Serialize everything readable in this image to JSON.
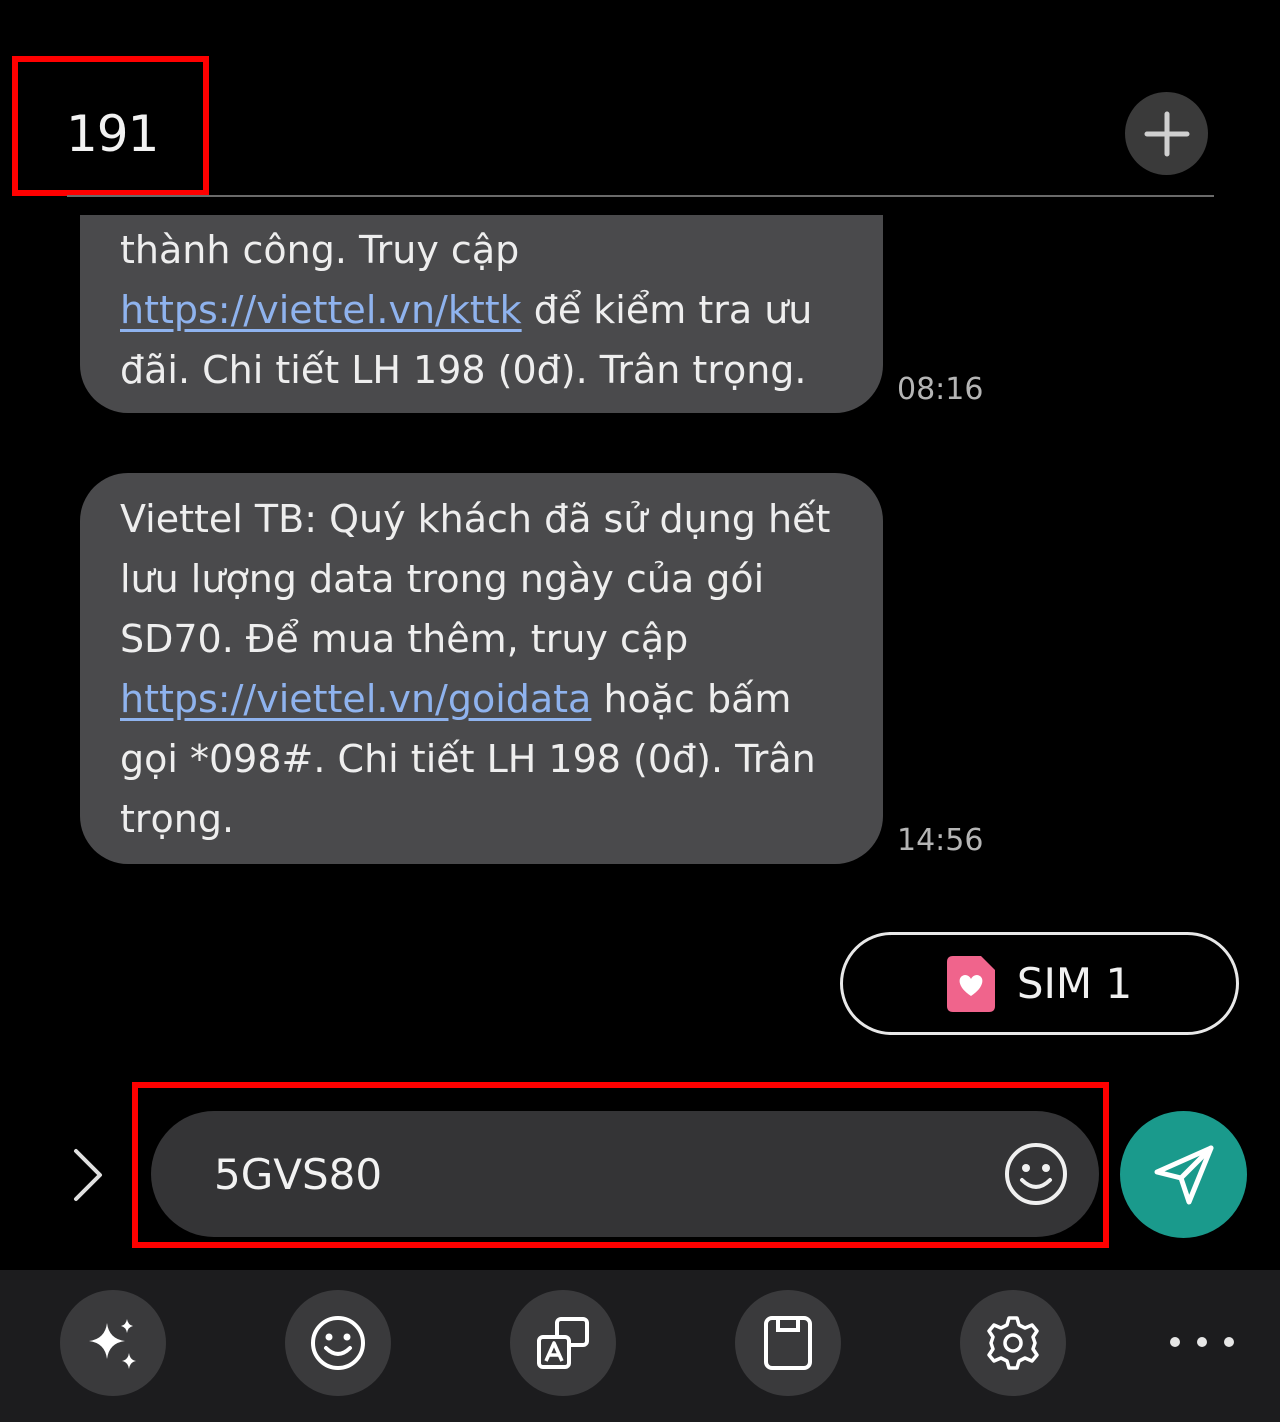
{
  "header": {
    "recipient": "191"
  },
  "messages": [
    {
      "parts": [
        {
          "text": "thành công. Truy cập "
        },
        {
          "link": "https://viettel.vn/kttk"
        },
        {
          "text": " để kiểm tra ưu đãi. Chi tiết LH 198 (0đ). Trân trọng."
        }
      ],
      "time": "08:16"
    },
    {
      "parts": [
        {
          "text": "Viettel TB: Quý khách đã sử dụng hết lưu lượng data trong ngày của gói SD70. Để mua thêm, truy cập "
        },
        {
          "link": "https://viettel.vn/goidata"
        },
        {
          "text": " hoặc bấm gọi *098#. Chi tiết LH 198 (0đ). Trân trọng."
        }
      ],
      "time": "14:56"
    }
  ],
  "sim": {
    "label": "SIM 1",
    "color": "#f0648c"
  },
  "composer": {
    "value": "5GVS80"
  },
  "colors": {
    "send": "#1a9a8c",
    "highlight": "#ff0000",
    "bubble": "#4a4a4c",
    "link": "#8fb3ee"
  },
  "toolbar": {
    "icons": [
      "sparkle-icon",
      "emoji-icon",
      "translate-icon",
      "clipboard-icon",
      "settings-icon",
      "more-icon"
    ]
  }
}
